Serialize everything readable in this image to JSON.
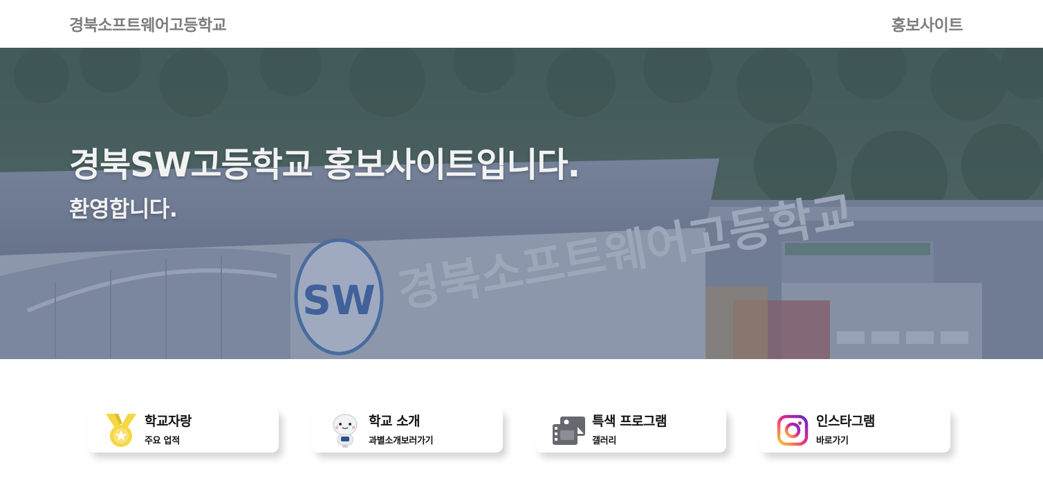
{
  "header": {
    "brand": "경북소프트웨어고등학교",
    "nav_link": "홍보사이트"
  },
  "hero": {
    "title": "경북SW고등학교 홍보사이트입니다.",
    "subtitle": "환영합니다.",
    "building_sign": "경북소프트웨어고등학교",
    "emblem_text": "SW"
  },
  "cards": [
    {
      "title": "학교자랑",
      "subtitle": "주요 업적",
      "icon": "medal-icon"
    },
    {
      "title": "학교 소개",
      "subtitle": "과별소개보러가기",
      "icon": "robot-mascot-icon"
    },
    {
      "title": "특색 프로그램",
      "subtitle": "갤러리",
      "icon": "gallery-icon"
    },
    {
      "title": "인스타그램",
      "subtitle": "바로가기",
      "icon": "instagram-icon"
    }
  ],
  "colors": {
    "header_text": "#7d7d7d",
    "hero_overlay": "#4a5c80",
    "hero_text": "#f2f2f2",
    "medal_gold": "#f5d742",
    "instagram_gradient": [
      "#f9ce34",
      "#ee2a7b",
      "#6228d7"
    ]
  }
}
